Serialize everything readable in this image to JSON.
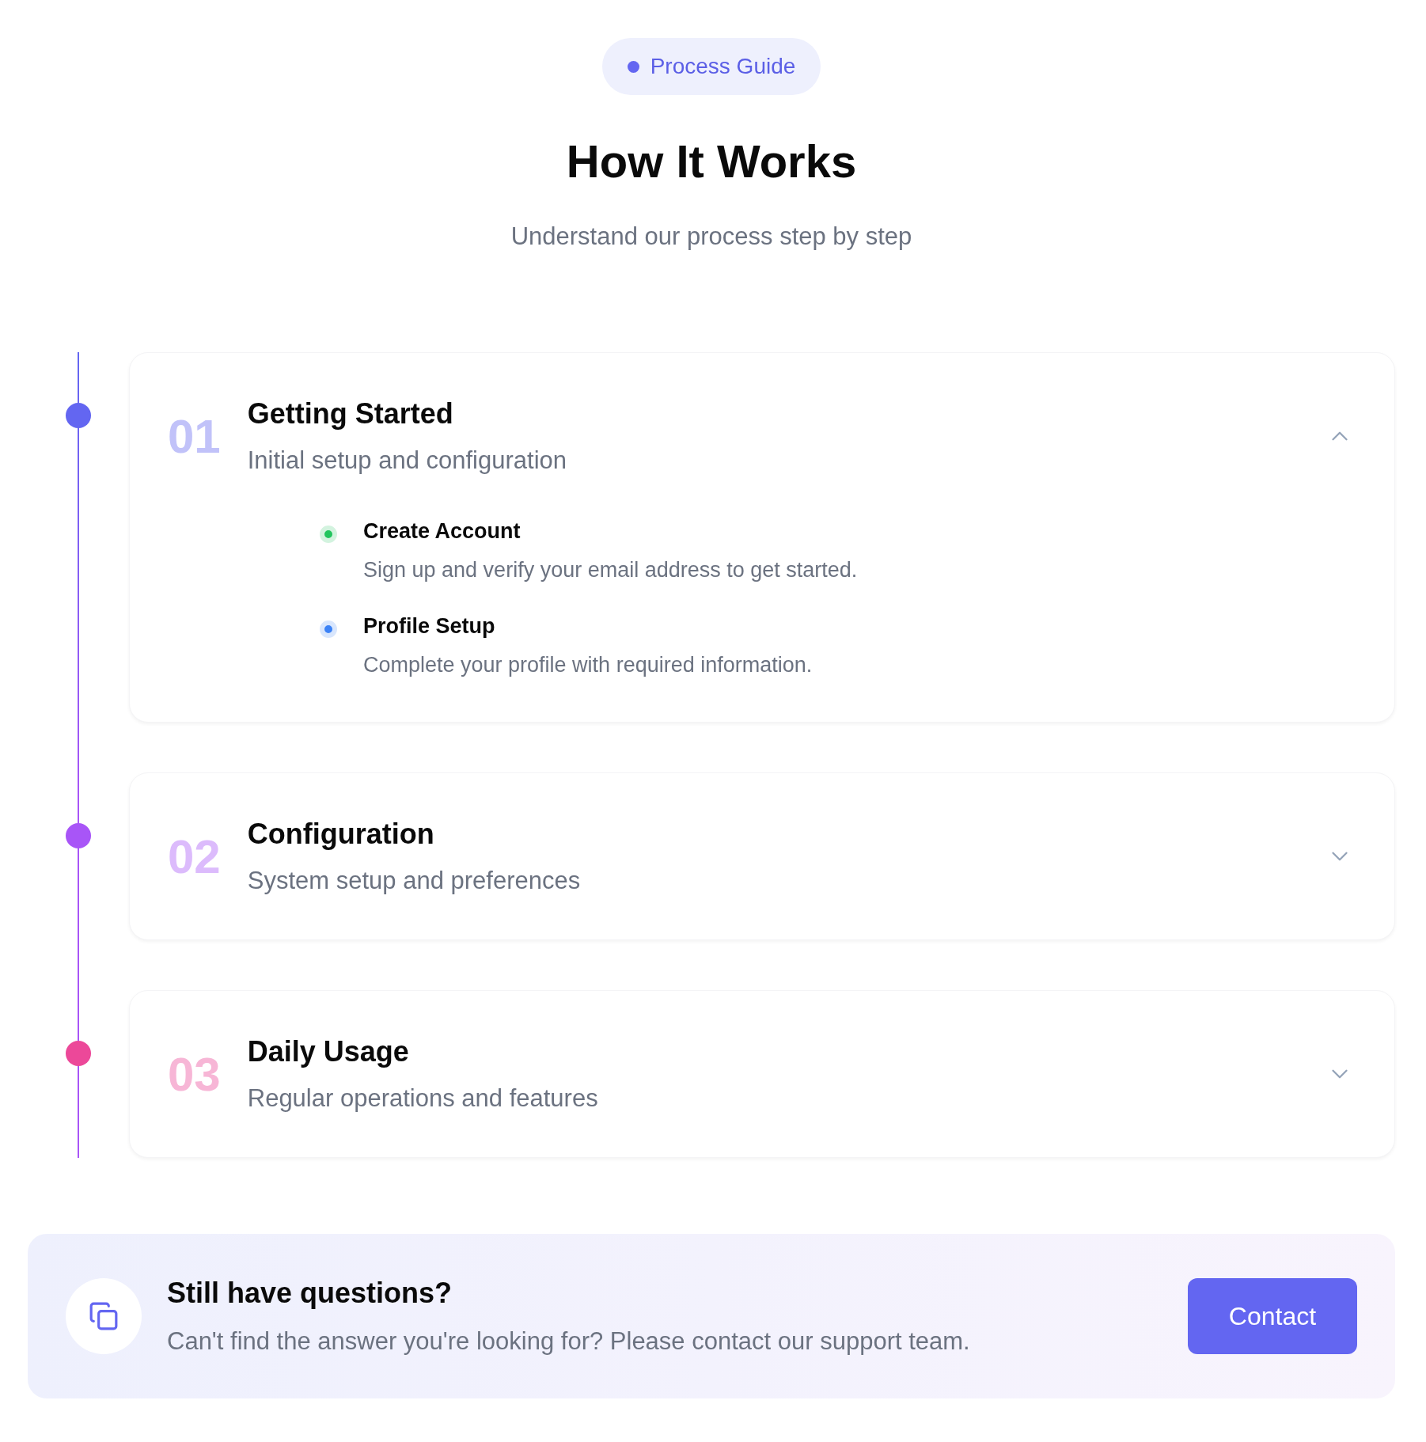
{
  "badge": {
    "label": "Process Guide"
  },
  "title": "How It Works",
  "subtitle": "Understand our process step by step",
  "steps": [
    {
      "number": "01",
      "title": "Getting Started",
      "description": "Initial setup and configuration",
      "color": "#6366f1",
      "expanded": true,
      "items": [
        {
          "title": "Create Account",
          "description": "Sign up and verify your email address to get started.",
          "color": "#22c55e"
        },
        {
          "title": "Profile Setup",
          "description": "Complete your profile with required information.",
          "color": "#3b82f6"
        }
      ]
    },
    {
      "number": "02",
      "title": "Configuration",
      "description": "System setup and preferences",
      "color": "#a855f7",
      "expanded": false
    },
    {
      "number": "03",
      "title": "Daily Usage",
      "description": "Regular operations and features",
      "color": "#ec4899",
      "expanded": false
    }
  ],
  "help": {
    "title": "Still have questions?",
    "text": "Can't find the answer you're looking for? Please contact our support team.",
    "button": "Contact"
  }
}
